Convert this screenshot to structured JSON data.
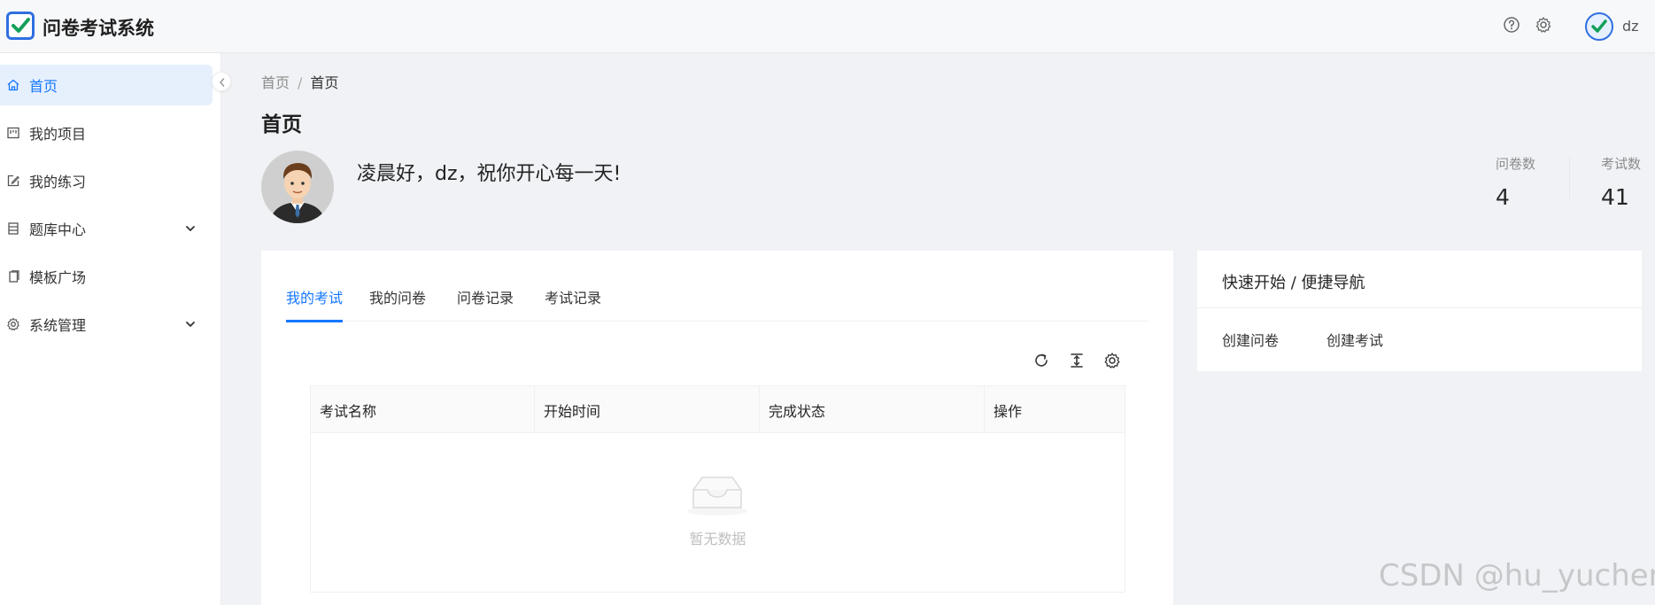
{
  "header": {
    "app_title": "问卷考试系统",
    "user_name": "dz",
    "icons": [
      "help-icon",
      "settings-icon"
    ]
  },
  "sidebar": {
    "items": [
      {
        "label": "首页",
        "icon": "home-icon",
        "active": true
      },
      {
        "label": "我的项目",
        "icon": "project-icon"
      },
      {
        "label": "我的练习",
        "icon": "edit-icon"
      },
      {
        "label": "题库中心",
        "icon": "database-icon",
        "expandable": true
      },
      {
        "label": "模板广场",
        "icon": "template-icon"
      },
      {
        "label": "系统管理",
        "icon": "gear-icon",
        "expandable": true
      }
    ]
  },
  "breadcrumb": {
    "root": "首页",
    "separator": "/",
    "current": "首页"
  },
  "page": {
    "title": "首页",
    "greeting": "凌晨好，dz，祝你开心每一天!"
  },
  "stats": [
    {
      "label": "问卷数",
      "value": "4"
    },
    {
      "label": "考试数",
      "value": "41"
    }
  ],
  "tabs": [
    {
      "label": "我的考试",
      "active": true
    },
    {
      "label": "我的问卷"
    },
    {
      "label": "问卷记录"
    },
    {
      "label": "考试记录"
    }
  ],
  "table": {
    "columns": [
      "考试名称",
      "开始时间",
      "完成状态",
      "操作"
    ],
    "empty_text": "暂无数据"
  },
  "quick_nav": {
    "title": "快速开始 / 便捷导航",
    "links": [
      "创建问卷",
      "创建考试"
    ]
  },
  "watermark": "CSDN @hu_yuchen",
  "colors": {
    "accent": "#1677ff",
    "logo": "#2f6fe0",
    "check": "#13a05a"
  }
}
